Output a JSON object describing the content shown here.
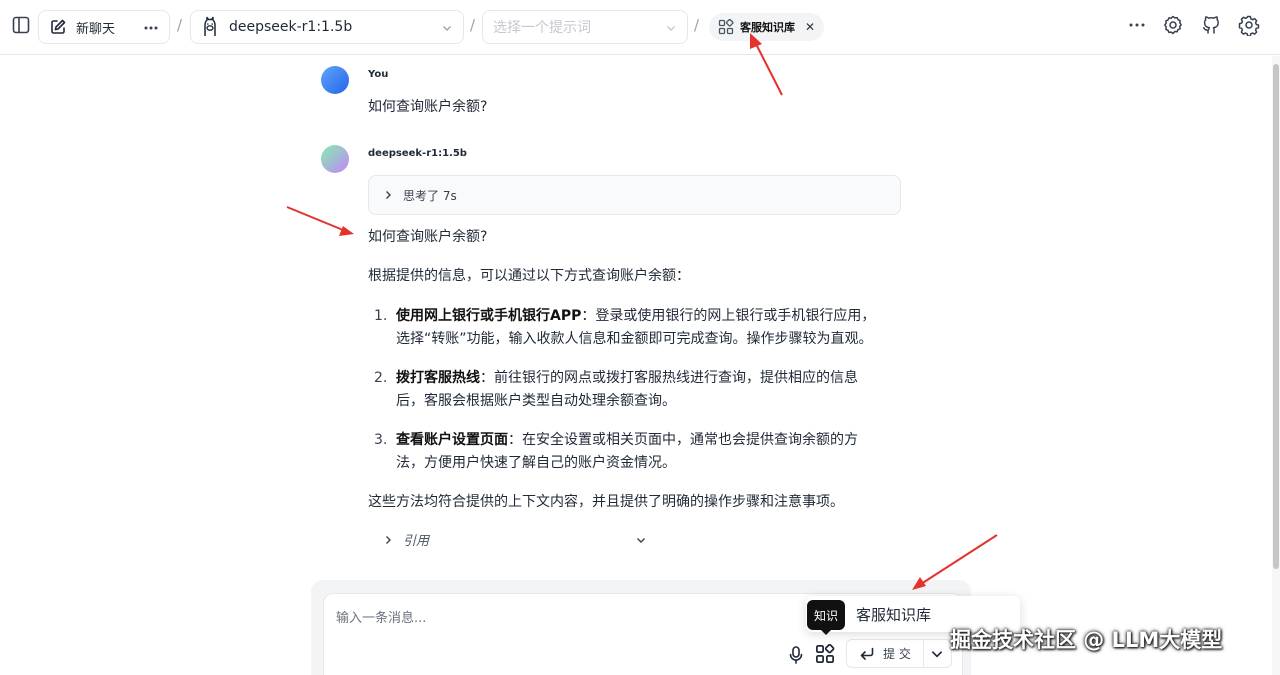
{
  "header": {
    "new_chat_label": "新聊天",
    "separator": "/",
    "model": "deepseek-r1:1.5b",
    "prompt_placeholder": "选择一个提示词",
    "knowledge_chip": "客服知识库"
  },
  "conversation": {
    "user_name": "You",
    "user_message": "如何查询账户余额?",
    "bot_name": "deepseek-r1:1.5b",
    "thinking_label": "思考了 7s",
    "answer_question": "如何查询账户余额?",
    "answer_intro": "根据提供的信息，可以通过以下方式查询账户余额：",
    "steps": [
      {
        "num": "1.",
        "title": "使用网上银行或手机银行APP",
        "rest": "：登录或使用银行的网上银行或手机银行应用，",
        "line2": "选择“转账”功能，输入收款人信息和金额即可完成查询。操作步骤较为直观。"
      },
      {
        "num": "2.",
        "title": "拨打客服热线",
        "rest": "：前往银行的网点或拨打客服热线进行查询，提供相应的信息",
        "line2": "后，客服会根据账户类型自动处理余额查询。"
      },
      {
        "num": "3.",
        "title": "查看账户设置页面",
        "rest": "：在安全设置或相关页面中，通常也会提供查询余额的方",
        "line2": "法，方便用户快速了解自己的账户资金情况。"
      }
    ],
    "answer_outro": "这些方法均符合提供的上下文内容，并且提供了明确的操作步骤和注意事项。",
    "citation_label": "引用"
  },
  "input": {
    "placeholder": "输入一条消息...",
    "submit_label": "提 交"
  },
  "knowledge_popover": {
    "item": "客服知识库",
    "tooltip": "知识"
  },
  "watermark": "掘金技术社区 @ LLM大模型",
  "colors": {
    "annotation_arrow": "#e5322d",
    "border": "#e5e7eb",
    "tooltip_bg": "#111111"
  }
}
